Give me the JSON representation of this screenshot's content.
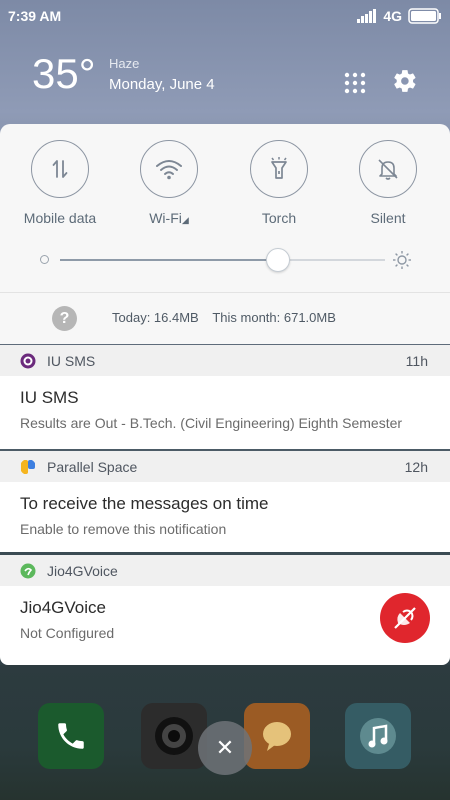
{
  "status_bar": {
    "time": "7:39 AM",
    "network": "4G"
  },
  "weather": {
    "temperature": "35°",
    "condition": "Haze",
    "date": "Monday, June 4"
  },
  "quick_settings": {
    "toggles": [
      {
        "label": "Mobile data",
        "icon": "mobile-data-icon"
      },
      {
        "label": "Wi-Fi",
        "icon": "wifi-icon"
      },
      {
        "label": "Torch",
        "icon": "torch-icon"
      },
      {
        "label": "Silent",
        "icon": "silent-bell-icon"
      }
    ],
    "brightness_level": 0.67,
    "data_usage": {
      "today": "Today: 16.4MB",
      "month": "This month: 671.0MB"
    }
  },
  "notifications": [
    {
      "app": "IU SMS",
      "time": "11h",
      "title": "IU SMS",
      "text": "Results are Out - B.Tech. (Civil Engineering) Eighth Semester"
    },
    {
      "app": "Parallel Space",
      "time": "12h",
      "title": "To receive the messages on time",
      "text": "Enable to remove this notification"
    },
    {
      "app": "Jio4GVoice",
      "time": "",
      "title": "Jio4GVoice",
      "text": "Not Configured"
    }
  ],
  "colors": {
    "accent_red": "#e0262d",
    "panel_bg": "#f7f7f7",
    "header_bg": "#f0f0f0"
  }
}
